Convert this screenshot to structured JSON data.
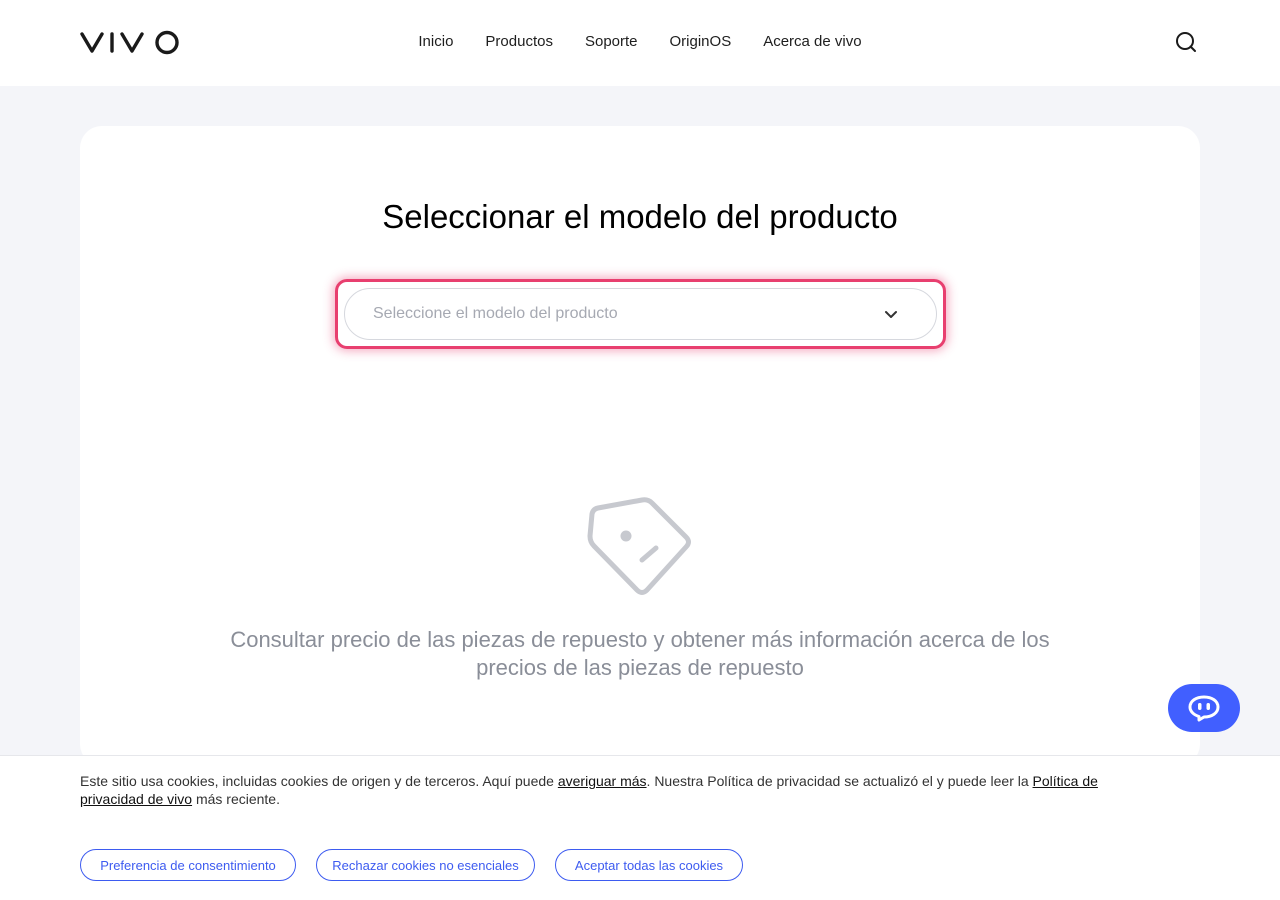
{
  "header": {
    "logo_text": "vivo",
    "nav": [
      "Inicio",
      "Productos",
      "Soporte",
      "OriginOS",
      "Acerca de vivo"
    ],
    "search_icon": "search-icon"
  },
  "main": {
    "title": "Seleccionar el modelo del producto",
    "select_placeholder": "Seleccione el modelo del producto",
    "empty_icon": "price-tag-icon",
    "empty_text_line1": "Consultar precio de las piezas de repuesto y obtener más información acerca de los",
    "empty_text_line2": "precios de las piezas de repuesto",
    "accent_color": "#e83f6f"
  },
  "chat": {
    "icon": "chat-bot-icon",
    "color": "#415fff"
  },
  "cookie": {
    "text_1": "Este sitio usa cookies, incluidas cookies de origen y de terceros. Aquí puede ",
    "link_1": "averiguar más",
    "text_2": ". Nuestra Política de privacidad se actualizó el y puede leer la ",
    "link_2": "Política de privacidad de vivo",
    "text_3": " más reciente.",
    "buttons": [
      "Preferencia de consentimiento",
      "Rechazar cookies no esenciales",
      "Aceptar todas las cookies"
    ],
    "button_color": "#3d5bf0"
  }
}
